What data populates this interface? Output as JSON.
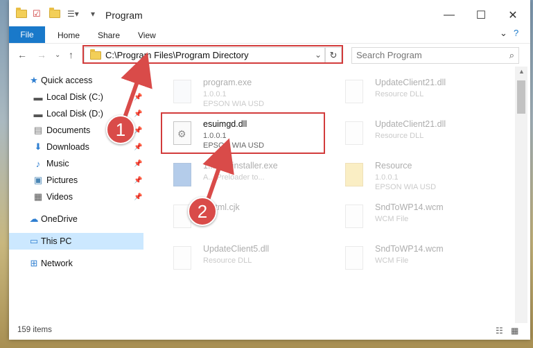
{
  "window": {
    "title": "Program"
  },
  "ribbon": {
    "file": "File",
    "home": "Home",
    "share": "Share",
    "view": "View"
  },
  "address": {
    "path": "C:\\Program Files\\Program Directory"
  },
  "search": {
    "placeholder": "Search Program"
  },
  "sidebar": {
    "items": [
      {
        "label": "Quick access"
      },
      {
        "label": "Local Disk (C:)"
      },
      {
        "label": "Local Disk (D:)"
      },
      {
        "label": "Documents"
      },
      {
        "label": "Downloads"
      },
      {
        "label": "Music"
      },
      {
        "label": "Pictures"
      },
      {
        "label": "Videos"
      },
      {
        "label": "OneDrive"
      },
      {
        "label": "This PC"
      },
      {
        "label": "Network"
      }
    ]
  },
  "files": [
    {
      "name": "program.exe",
      "line2": "1.0.0.1",
      "line3": "EPSON WIA USD"
    },
    {
      "name": "UpdateClient21.dll",
      "line2": "Resource DLL",
      "line3": ""
    },
    {
      "name": "esuimgd.dll",
      "line2": "1.0.0.1",
      "line3": "EPSON WIA USD"
    },
    {
      "name": "UpdateClient21.dll",
      "line2": "Resource DLL",
      "line3": ""
    },
    {
      "name": "1...dmdinstaller.exe",
      "line2": "A... Preloader to...",
      "line3": ""
    },
    {
      "name": "Resource",
      "line2": "1.0.0.1",
      "line3": "EPSON WIA USD"
    },
    {
      "name": "...html.cjk",
      "line2": "...",
      "line3": ""
    },
    {
      "name": "SndToWP14.wcm",
      "line2": "WCM File",
      "line3": ""
    },
    {
      "name": "UpdateClient5.dll",
      "line2": "Resource DLL",
      "line3": ""
    },
    {
      "name": "SndToWP14.wcm",
      "line2": "WCM File",
      "line3": ""
    }
  ],
  "status": {
    "count": "159 items"
  },
  "callouts": {
    "one": "1",
    "two": "2"
  },
  "colors": {
    "accent": "#1979ca",
    "highlight": "#d23b3b",
    "selected": "#cce8ff"
  }
}
